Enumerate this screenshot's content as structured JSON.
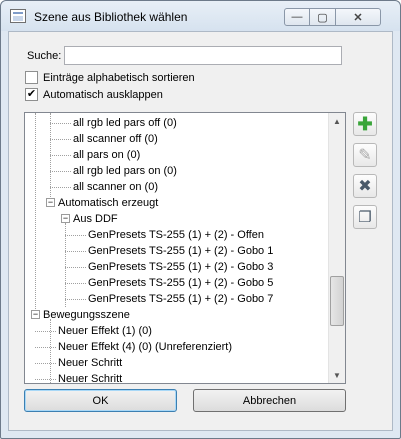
{
  "window": {
    "title": "Szene aus Bibliothek wählen",
    "close_glyph": "✕",
    "min_glyph": "—",
    "max_glyph": "▢"
  },
  "search": {
    "label": "Suche:",
    "value": "",
    "placeholder": ""
  },
  "options": [
    {
      "label": "Einträge alphabetisch sortieren",
      "checked": false
    },
    {
      "label": "Automatisch ausklappen",
      "checked": true
    }
  ],
  "tree": {
    "rows": [
      {
        "text": "all rgb led pars off (0)",
        "level": 2
      },
      {
        "text": "all scanner off (0)",
        "level": 2
      },
      {
        "text": "all pars on (0)",
        "level": 2
      },
      {
        "text": "all rgb led pars on (0)",
        "level": 2
      },
      {
        "text": "all scanner on (0)",
        "level": 2
      },
      {
        "text": "Automatisch erzeugt",
        "level": 1,
        "expander": "−"
      },
      {
        "text": "Aus DDF",
        "level": 2,
        "expander": "−"
      },
      {
        "text": "GenPresets TS-255 (1) + (2) - Offen",
        "level": 3
      },
      {
        "text": "GenPresets TS-255 (1) + (2) - Gobo 1",
        "level": 3
      },
      {
        "text": "GenPresets TS-255 (1) + (2) - Gobo 3",
        "level": 3
      },
      {
        "text": "GenPresets TS-255 (1) + (2) - Gobo 5",
        "level": 3
      },
      {
        "text": "GenPresets TS-255 (1) + (2) - Gobo 7",
        "level": 3
      },
      {
        "text": "Bewegungsszene",
        "level": 0,
        "expander": "−"
      },
      {
        "text": "Neuer Effekt (1) (0)",
        "level": 1
      },
      {
        "text": "Neuer Effekt (4) (0) (Unreferenziert)",
        "level": 1
      },
      {
        "text": "Neuer Schritt",
        "level": 1
      },
      {
        "text": "Neuer Schritt",
        "level": 1
      }
    ],
    "scroll_position": 0.78
  },
  "side_buttons": [
    {
      "icon": "add-icon",
      "glyph": "✚",
      "color": "#3aa53a",
      "enabled": true
    },
    {
      "icon": "edit-icon",
      "glyph": "✎",
      "color": "#a0a0a0",
      "enabled": false
    },
    {
      "icon": "delete-icon",
      "glyph": "✖",
      "color": "#4a5a6a",
      "enabled": true
    },
    {
      "icon": "copy-icon",
      "glyph": "❐",
      "color": "#4a5a6a",
      "enabled": true
    }
  ],
  "buttons": {
    "ok": "OK",
    "cancel": "Abbrechen"
  },
  "colors": {
    "accent": "#3c7fb1",
    "add_green": "#3aa53a"
  }
}
